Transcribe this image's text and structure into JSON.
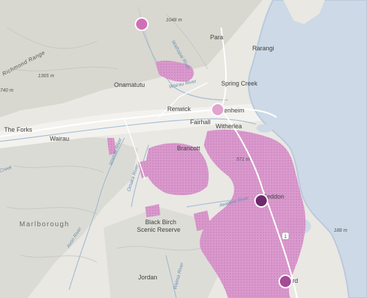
{
  "map": {
    "colors": {
      "land": "#e9e8e3",
      "hills": "#d6d6cf",
      "valley": "#f3f2ee",
      "water": "#cdd9e6",
      "coast": "#b9c9dc",
      "river": "#9cb7d3",
      "road": "#ffffff",
      "highlight": "#d68fc8",
      "highlight_dark": "#c574b6"
    },
    "places": {
      "para": "Para",
      "rarangi": "Rarangi",
      "onamatutu": "Onamatutu",
      "spring_creek": "Spring Creek",
      "renwick": "Renwick",
      "blenheim": "Blenheim",
      "fairhall": "Fairhall",
      "witherlea": "Witherlea",
      "the_forks": "The Forks",
      "wairau": "Wairau",
      "brancott": "Brancott",
      "seddon": "Seddon",
      "black_birch": "Black Birch",
      "scenic_reserve": "Scenic Reserve",
      "jordan": "Jordan",
      "ward": "Ward"
    },
    "region_label": "Marlborough",
    "range_label": "Richmond Range",
    "elevations": {
      "e1048": "1048 m",
      "e1365": "1365 m",
      "e740": "740 m",
      "e571": "571 m",
      "e188": "188 m"
    },
    "rivers": {
      "waihopai": "Waihopai River",
      "wairau_river": "Wairau River",
      "awatere": "Awatere River",
      "waitohi": "Waitohi River",
      "omaka": "Omaka River",
      "creek": "Creek",
      "avon": "Avon River",
      "waima": "Waima River"
    },
    "highway_shield": "1",
    "markers": [
      {
        "name": "marker-top",
        "color": "#cf6fb5",
        "size": 1
      },
      {
        "name": "marker-blenheim",
        "color": "#e0a4cf",
        "size": 1
      },
      {
        "name": "marker-seddon",
        "color": "#6e2a6b",
        "size": 1
      },
      {
        "name": "marker-ward",
        "color": "#a34b94",
        "size": 1
      }
    ]
  }
}
